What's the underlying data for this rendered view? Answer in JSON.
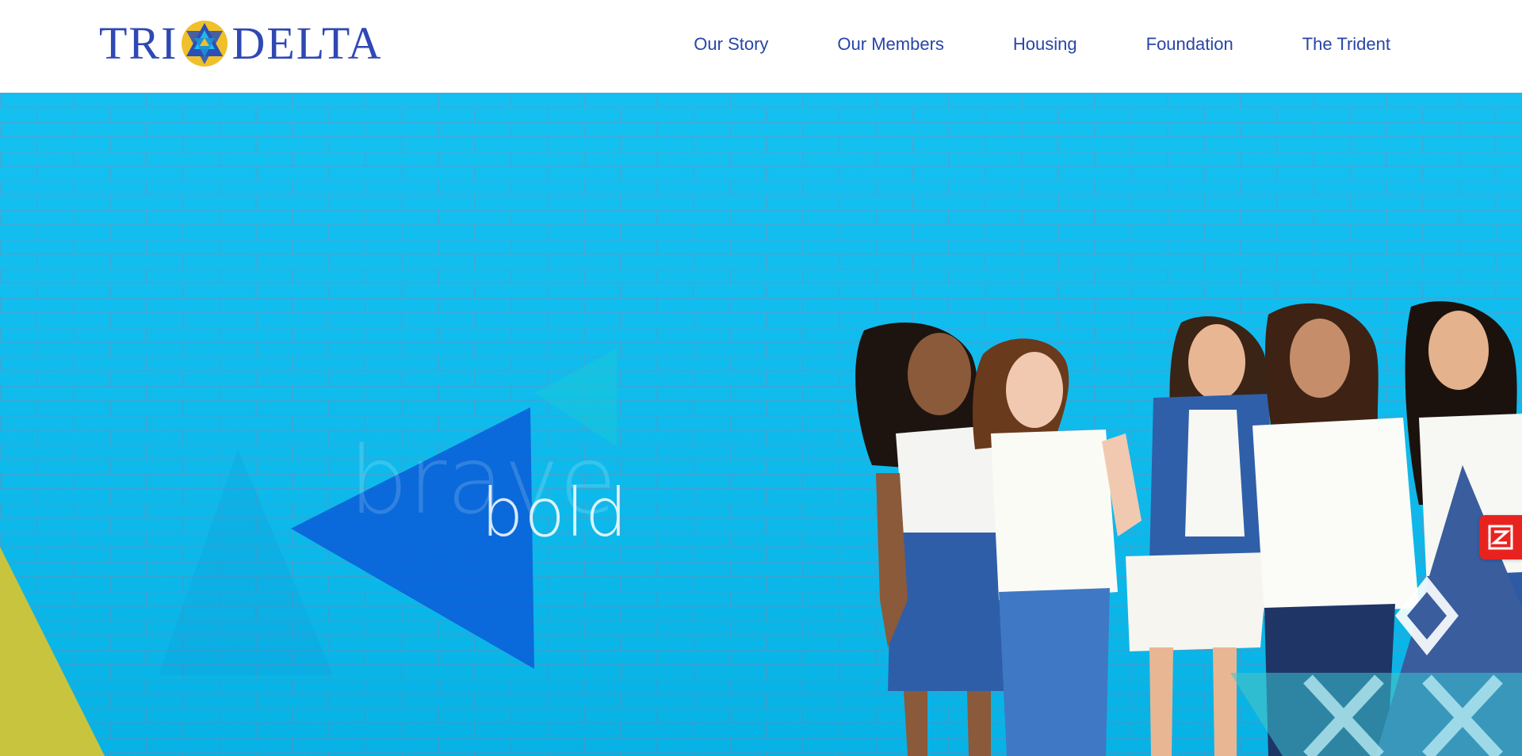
{
  "header": {
    "logo": {
      "left_text": "TRI",
      "right_text": "DELTA",
      "emblem_icon": "tri-delta-emblem-icon"
    },
    "nav": [
      {
        "label": "Our Story"
      },
      {
        "label": "Our Members"
      },
      {
        "label": "Housing"
      },
      {
        "label": "Foundation"
      },
      {
        "label": "The Trident"
      }
    ]
  },
  "hero": {
    "faint_word": "brave",
    "main_word": "bold",
    "photo_description_icon": "group-photo-image",
    "wall_color": "#07bdf0",
    "accent_blue": "#0a5fd8",
    "accent_yellow": "#c9c43d"
  },
  "widget": {
    "icon": "zoominfo-icon",
    "color": "#e8231f"
  },
  "colors": {
    "brand_blue": "#2f48b4",
    "nav_blue": "#2845a8",
    "emblem_gold": "#f0c02a"
  }
}
